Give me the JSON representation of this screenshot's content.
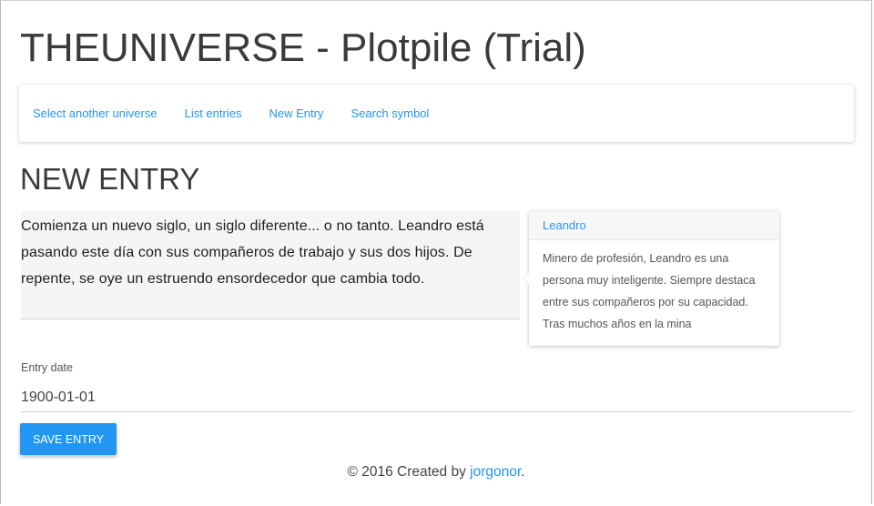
{
  "app": {
    "title": "THEUNIVERSE - Plotpile (Trial)"
  },
  "nav": {
    "items": [
      {
        "label": "Select another universe"
      },
      {
        "label": "List entries"
      },
      {
        "label": "New Entry"
      },
      {
        "label": "Search symbol"
      }
    ]
  },
  "page": {
    "title": "NEW ENTRY"
  },
  "editor": {
    "text": "Comienza un nuevo siglo, un siglo diferente... o no tanto. Leandro está pasando este día con sus compañeros de trabajo y sus dos hijos. De repente, se oye un estruendo ensordecedor que cambia todo."
  },
  "popover": {
    "title": "Leandro",
    "body": "Minero de profesión, Leandro es una persona muy inteligente. Siempre destaca entre sus compañeros por su capacidad. Tras muchos años en la mina"
  },
  "form": {
    "date_label": "Entry date",
    "date_value": "1900-01-01",
    "save_label": "SAVE ENTRY"
  },
  "footer": {
    "prefix": "© 2016 Created by ",
    "author": "jorgonor",
    "suffix": "."
  },
  "colors": {
    "accent": "#2196f3",
    "editor_bg": "#f5f5f5"
  }
}
